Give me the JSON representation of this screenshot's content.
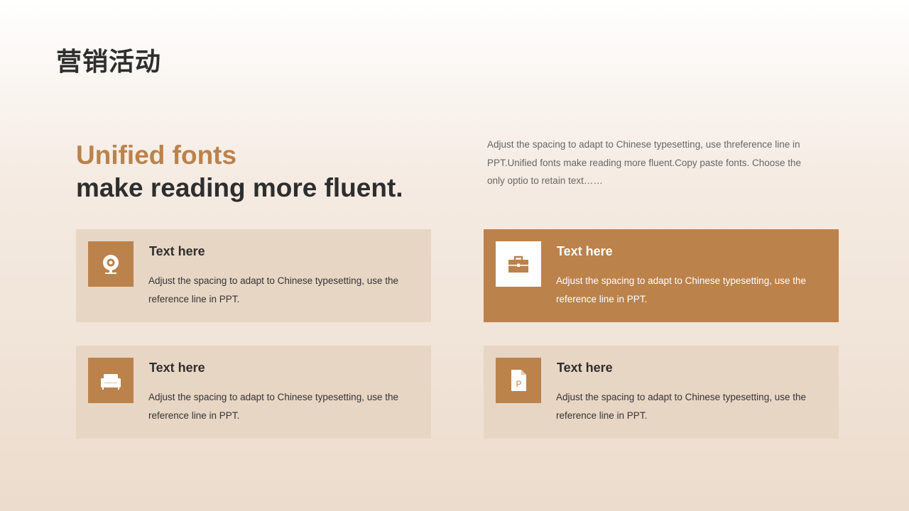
{
  "page": {
    "title": "营销活动"
  },
  "headline": {
    "accent": "Unified fonts",
    "main": "make reading more fluent."
  },
  "intro": "Adjust the spacing to adapt to Chinese typesetting, use threference line in PPT.Unified fonts make reading more fluent.Copy paste fonts. Choose the only optio to retain text……",
  "colors": {
    "accent": "#bb824b",
    "card_bg": "#e8d6c5",
    "title": "#2e2e2e"
  },
  "cards": [
    {
      "icon": "webcam-icon",
      "title": "Text here",
      "text": "Adjust the spacing to adapt to Chinese typesetting, use the reference line in PPT."
    },
    {
      "icon": "briefcase-icon",
      "title": "Text here",
      "text": "Adjust the spacing to adapt to Chinese typesetting, use the reference line in PPT."
    },
    {
      "icon": "sofa-icon",
      "title": "Text here",
      "text": "Adjust the spacing to adapt to Chinese typesetting, use the reference line in PPT."
    },
    {
      "icon": "document-icon",
      "title": "Text here",
      "text": "Adjust the spacing to adapt to Chinese typesetting, use the reference line in PPT."
    }
  ]
}
